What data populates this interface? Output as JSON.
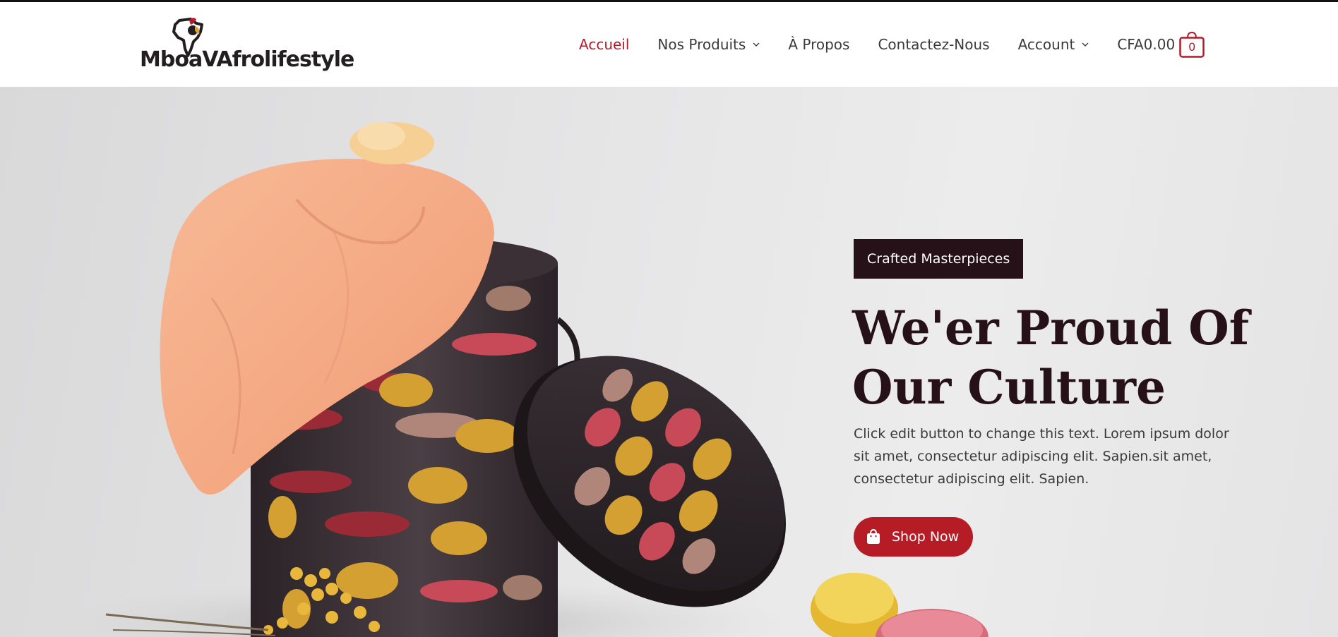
{
  "brand": {
    "name_left": "Mboa",
    "name_right": "Afrolifestyle"
  },
  "nav": {
    "items": [
      {
        "label": "Accueil",
        "active": true,
        "dropdown": false
      },
      {
        "label": "Nos Produits",
        "active": false,
        "dropdown": true
      },
      {
        "label": "À Propos",
        "active": false,
        "dropdown": false
      },
      {
        "label": "Contactez-Nous",
        "active": false,
        "dropdown": false
      },
      {
        "label": "Account",
        "active": false,
        "dropdown": true
      }
    ],
    "cart": {
      "total": "CFA0.00",
      "count": "0"
    }
  },
  "hero": {
    "badge": "Crafted Masterpieces",
    "title": "We'er Proud Of Our Culture",
    "text": "Click edit button to change this text. Lorem ipsum dolor sit amet, consectetur adipiscing elit. Sapien.sit amet, consectetur adipiscing elit. Sapien.",
    "button_label": "Shop Now"
  },
  "colors": {
    "accent": "#b31b2a",
    "dark": "#261118",
    "button": "#b51c26",
    "hero_bg": "#e4e4e5"
  },
  "icons": {
    "cart": "shopping-bag-icon",
    "button": "shopping-bag-icon",
    "dropdown": "chevron-down-icon"
  }
}
